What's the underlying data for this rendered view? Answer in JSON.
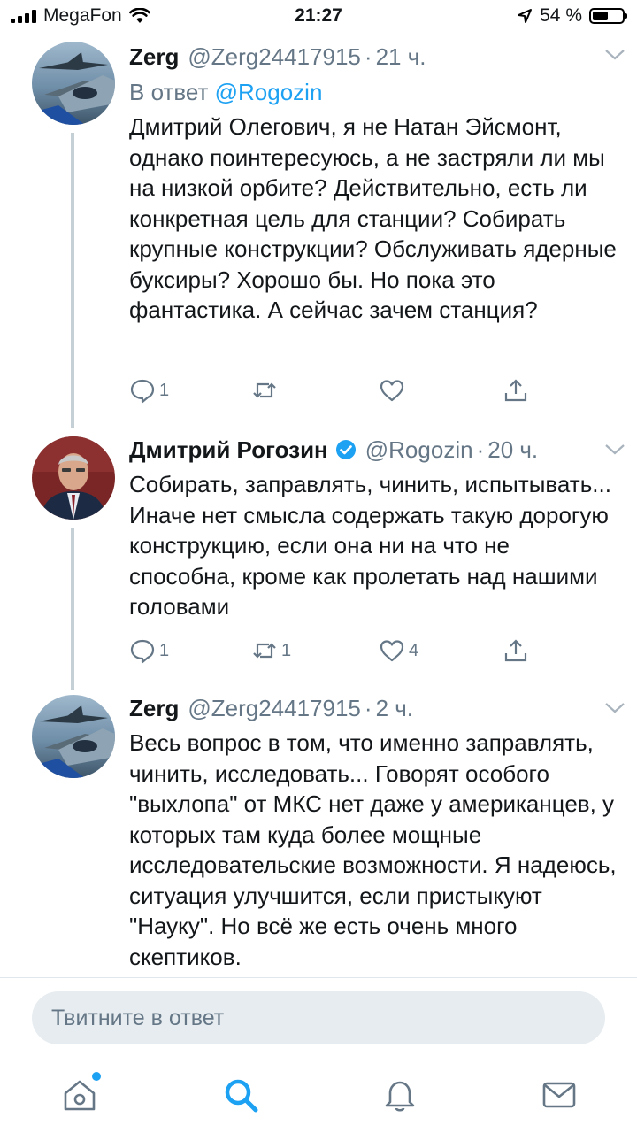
{
  "status_bar": {
    "carrier": "MegaFon",
    "time": "21:27",
    "battery_percent": "54 %",
    "battery_level": 0.54
  },
  "tweets": [
    {
      "name": "Zerg",
      "handle": "@Zerg24417915",
      "time": "21 ч.",
      "reply_prefix": "В ответ",
      "reply_mention": "@Rogozin",
      "text": "Дмитрий Олегович, я не Натан Эйсмонт, однако поинтересуюсь, а не застряли ли мы на низкой орбите? Действительно, есть ли конкретная цель для станции? Собирать крупные конструкции? Обслуживать ядерные буксиры? Хорошо бы. Но пока это фантастика. А сейчас  зачем станция?",
      "replies": "1",
      "retweets": "",
      "likes": ""
    },
    {
      "name": "Дмитрий Рогозин",
      "handle": "@Rogozin",
      "time": "20 ч.",
      "text": "Собирать, заправлять, чинить, испытывать... Иначе нет смысла содержать такую дорогую конструкцию, если она ни на что не способна, кроме как пролетать над нашими головами",
      "replies": "1",
      "retweets": "1",
      "likes": "4"
    },
    {
      "name": "Zerg",
      "handle": "@Zerg24417915",
      "time": "2 ч.",
      "text": "Весь вопрос в том, что именно заправлять, чинить, исследовать... Говорят особого \"выхлопа\" от МКС нет даже у американцев, у которых там куда более мощные исследовательские возможности. Я надеюсь, ситуация улучшится, если пристыкуют \"Науку\". Но всё же есть очень много скептиков."
    }
  ],
  "compose": {
    "placeholder": "Твитните в ответ"
  },
  "tabbar": {
    "items": [
      "home-icon",
      "search-icon",
      "bell-icon",
      "mail-icon"
    ],
    "active": "search-icon"
  },
  "colors": {
    "accent": "#1da1f2",
    "secondary_text": "#657786",
    "thread_line": "#c4cfd6"
  }
}
